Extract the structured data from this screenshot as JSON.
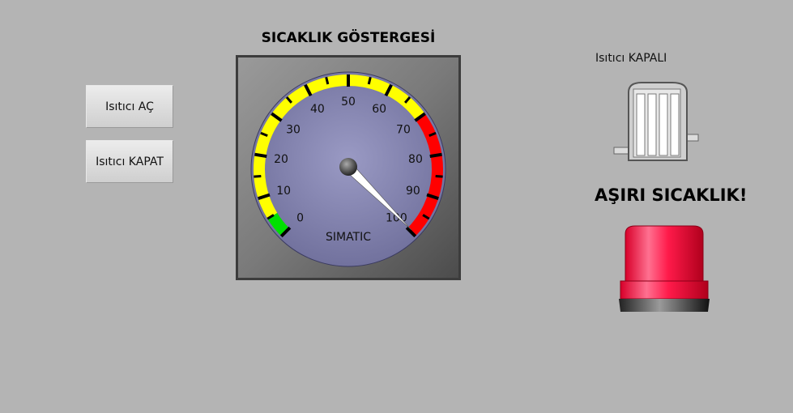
{
  "buttons": {
    "heater_on_label": "Isıtıcı AÇ",
    "heater_off_label": "Isıtıcı KAPAT"
  },
  "gauge": {
    "title": "SICAKLIK GÖSTERGESİ",
    "brand": "SIMATIC",
    "min": 0,
    "max": 100,
    "value": 100,
    "tick_labels": [
      "0",
      "10",
      "20",
      "30",
      "40",
      "50",
      "60",
      "70",
      "80",
      "90",
      "100"
    ],
    "zones": [
      {
        "from": 0,
        "to": 5,
        "color": "#00e000"
      },
      {
        "from": 5,
        "to": 70,
        "color": "#ffff00"
      },
      {
        "from": 70,
        "to": 100,
        "color": "#ff0000"
      }
    ]
  },
  "heater": {
    "status_label": "Isıtıcı KAPALI",
    "icon": "heater-icon"
  },
  "alarm": {
    "label": "AŞIRI SICAKLIK!",
    "icon": "alarm-lamp-icon",
    "color": "#e8002a"
  }
}
